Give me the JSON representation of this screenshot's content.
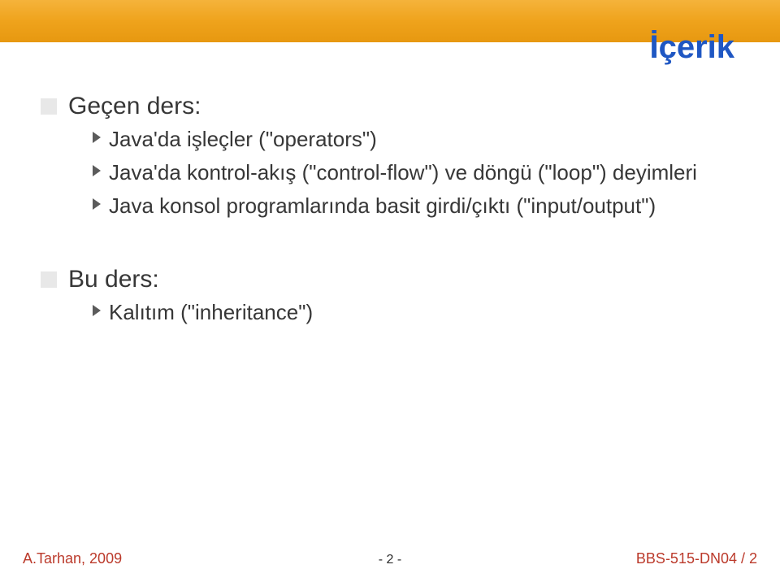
{
  "title": "İçerik",
  "sections": {
    "prev": {
      "heading": "Geçen ders:",
      "items": [
        "Java'da işleçler (\"operators\")",
        "Java'da kontrol-akış (\"control-flow\") ve döngü (\"loop\") deyimleri",
        "Java konsol programlarında basit girdi/çıktı (\"input/output\")"
      ]
    },
    "current": {
      "heading": "Bu ders:",
      "items": [
        "Kalıtım (\"inheritance\")"
      ]
    }
  },
  "footer": {
    "left": "A.Tarhan, 2009",
    "center": "- 2 -",
    "right": "BBS-515-DN04 / 2"
  }
}
